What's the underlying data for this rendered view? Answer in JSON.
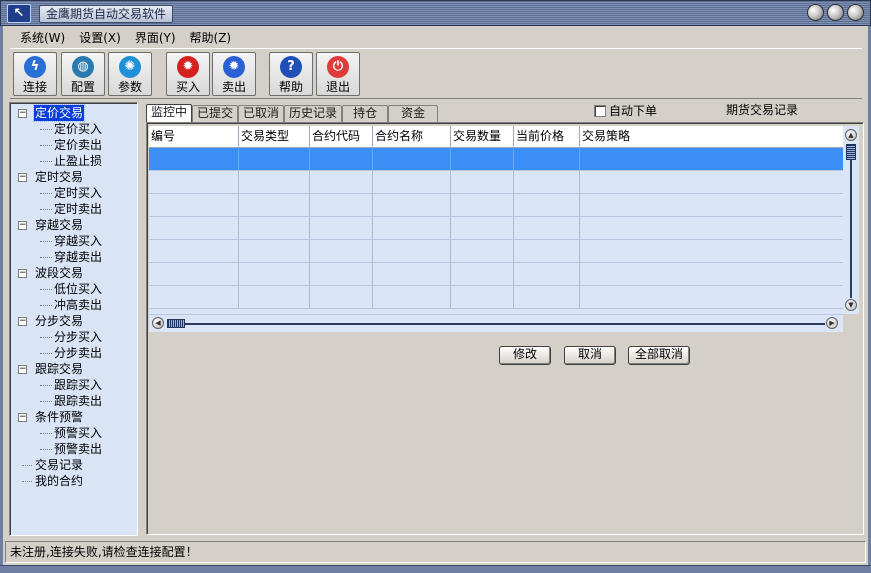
{
  "window": {
    "title": "金鹰期货自动交易软件",
    "logo_glyph": "↖"
  },
  "menu": [
    {
      "label": "系统(W)"
    },
    {
      "label": "设置(X)"
    },
    {
      "label": "界面(Y)"
    },
    {
      "label": "帮助(Z)"
    }
  ],
  "toolbar": {
    "connect": {
      "label": "连接",
      "icon": "lightning-globe-icon",
      "color": "#2a6fd6"
    },
    "config": {
      "label": "配置",
      "icon": "globe-icon",
      "color": "#2a7ab0"
    },
    "params": {
      "label": "参数",
      "icon": "gear-icon",
      "color": "#1f8fd8"
    },
    "buy": {
      "label": "买入",
      "icon": "red-gear-icon",
      "color": "#d62020"
    },
    "sell": {
      "label": "卖出",
      "icon": "blue-gear-icon",
      "color": "#2a5fd6"
    },
    "help": {
      "label": "帮助",
      "icon": "question-icon",
      "color": "#1f4fb8",
      "glyph": "?"
    },
    "exit": {
      "label": "退出",
      "icon": "power-icon",
      "color": "#e03a3a",
      "glyph": "⏻"
    }
  },
  "tree": {
    "groups": [
      {
        "label": "定价交易",
        "expander": "−",
        "selected": true,
        "children": [
          "定价买入",
          "定价卖出",
          "止盈止损"
        ]
      },
      {
        "label": "定时交易",
        "expander": "−",
        "children": [
          "定时买入",
          "定时卖出"
        ]
      },
      {
        "label": "穿越交易",
        "expander": "−",
        "children": [
          "穿越买入",
          "穿越卖出"
        ]
      },
      {
        "label": "波段交易",
        "expander": "−",
        "children": [
          "低位买入",
          "冲高卖出"
        ]
      },
      {
        "label": "分步交易",
        "expander": "−",
        "children": [
          "分步买入",
          "分步卖出"
        ]
      },
      {
        "label": "跟踪交易",
        "expander": "−",
        "children": [
          "跟踪买入",
          "跟踪卖出"
        ]
      },
      {
        "label": "条件预警",
        "expander": "−",
        "children": [
          "预警买入",
          "预警卖出"
        ]
      }
    ],
    "extras": [
      "交易记录",
      "我的合约"
    ]
  },
  "tabs": [
    "监控中",
    "已提交",
    "已取消",
    "历史记录",
    "持仓",
    "资金"
  ],
  "auto_order_label": "自动下单",
  "records_title": "期货交易记录",
  "grid": {
    "columns": [
      "编号",
      "交易类型",
      "合约代码",
      "合约名称",
      "交易数量",
      "当前价格",
      "交易策略"
    ],
    "selected_row": 0
  },
  "actions": {
    "modify": "修改",
    "cancel": "取消",
    "cancel_all": "全部取消"
  },
  "status": "未注册,连接失败,请检查连接配置！"
}
